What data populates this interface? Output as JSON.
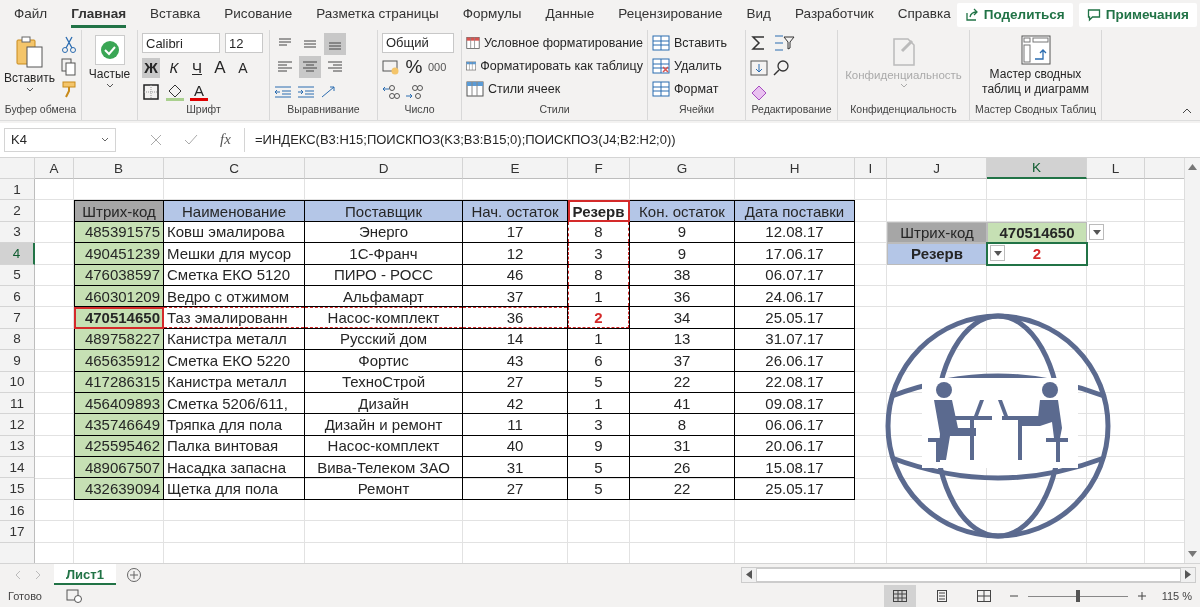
{
  "menu_tabs": [
    {
      "label": "Файл",
      "selected": false
    },
    {
      "label": "Главная",
      "selected": true
    },
    {
      "label": "Вставка",
      "selected": false
    },
    {
      "label": "Рисование",
      "selected": false
    },
    {
      "label": "Разметка страницы",
      "selected": false
    },
    {
      "label": "Формулы",
      "selected": false
    },
    {
      "label": "Данные",
      "selected": false
    },
    {
      "label": "Рецензирование",
      "selected": false
    },
    {
      "label": "Вид",
      "selected": false
    },
    {
      "label": "Разработчик",
      "selected": false
    },
    {
      "label": "Справка",
      "selected": false
    }
  ],
  "share_button": "Поделиться",
  "comments_button": "Примечания",
  "ribbon": {
    "clipboard": {
      "label": "Буфер обмена",
      "paste": "Вставить"
    },
    "quick": {
      "button": "Частые"
    },
    "font": {
      "label": "Шрифт",
      "font_name": "Calibri",
      "font_size": "12",
      "styles": [
        {
          "text": "Ж",
          "kind": "bold",
          "selected": true
        },
        {
          "text": "К",
          "kind": "italic",
          "selected": false
        },
        {
          "text": "Ч",
          "kind": "underline",
          "selected": false
        }
      ],
      "grow": "A",
      "shrink": "A",
      "color_letter": "A"
    },
    "alignment": {
      "label": "Выравнивание",
      "buttons": [
        {
          "kind": "top",
          "selected": false
        },
        {
          "kind": "middle",
          "selected": false
        },
        {
          "kind": "bottom",
          "selected": true
        },
        {
          "kind": "left",
          "selected": false
        },
        {
          "kind": "center",
          "selected": true
        },
        {
          "kind": "right",
          "selected": false
        }
      ]
    },
    "number": {
      "label": "Число",
      "format": "Общий",
      "percent": "%",
      "thousands": "000"
    },
    "styles": {
      "label": "Стили",
      "items": [
        "Условное форматирование",
        "Форматировать как таблицу",
        "Стили ячеек"
      ]
    },
    "cells": {
      "label": "Ячейки",
      "items": [
        "Вставить",
        "Удалить",
        "Формат"
      ]
    },
    "editing": {
      "label": "Редактирование"
    },
    "privacy": {
      "label": "Конфиденциальность",
      "button": "Конфиденциальность",
      "disabled": true
    },
    "pivot": {
      "label": "Мастер Сводных Таблиц",
      "button": "Мастер сводных таблиц и диаграмм"
    }
  },
  "name_box": "K4",
  "function_label": "fx",
  "formula": "=ИНДЕКС(B3:H15;ПОИСКПОЗ(K3;B3:B15;0);ПОИСКПОЗ(J4;B2:H2;0))",
  "columns": [
    {
      "letter": "A",
      "selected": false
    },
    {
      "letter": "B",
      "selected": false
    },
    {
      "letter": "C",
      "selected": false
    },
    {
      "letter": "D",
      "selected": false
    },
    {
      "letter": "E",
      "selected": false
    },
    {
      "letter": "F",
      "selected": false
    },
    {
      "letter": "G",
      "selected": false
    },
    {
      "letter": "H",
      "selected": false
    },
    {
      "letter": "I",
      "selected": false
    },
    {
      "letter": "J",
      "selected": false
    },
    {
      "letter": "K",
      "selected": true
    },
    {
      "letter": "L",
      "selected": false
    }
  ],
  "row_numbers": [
    {
      "number": "1",
      "selected": false
    },
    {
      "number": "2",
      "selected": false
    },
    {
      "number": "3",
      "selected": false
    },
    {
      "number": "4",
      "selected": true
    },
    {
      "number": "5",
      "selected": false
    },
    {
      "number": "6",
      "selected": false
    },
    {
      "number": "7",
      "selected": false
    },
    {
      "number": "8",
      "selected": false
    },
    {
      "number": "9",
      "selected": false
    },
    {
      "number": "10",
      "selected": false
    },
    {
      "number": "11",
      "selected": false
    },
    {
      "number": "12",
      "selected": false
    },
    {
      "number": "13",
      "selected": false
    },
    {
      "number": "14",
      "selected": false
    },
    {
      "number": "15",
      "selected": false
    },
    {
      "number": "16",
      "selected": false
    },
    {
      "number": "17",
      "selected": false
    }
  ],
  "table": {
    "header": [
      {
        "label": "Штрих-код",
        "color": "#a6a6a6",
        "highlighted": false
      },
      {
        "label": "Наименование",
        "color": "#b4c6e7",
        "highlighted": false
      },
      {
        "label": "Поставщик",
        "color": "#b4c6e7",
        "highlighted": false
      },
      {
        "label": "Нач. остаток",
        "color": "#b4c6e7",
        "highlighted": false
      },
      {
        "label": "Резерв",
        "color": "#ffffff",
        "highlighted": true
      },
      {
        "label": "Кон. остаток",
        "color": "#b4c6e7",
        "highlighted": false
      },
      {
        "label": "Дата поставки",
        "color": "#b4c6e7",
        "highlighted": false
      }
    ],
    "rows": [
      {
        "cells": [
          "485391575",
          "Ковш эмалирова",
          "Энерго",
          "17",
          "8",
          "9",
          "12.08.17"
        ],
        "highlighted": false
      },
      {
        "cells": [
          "490451239",
          "Мешки для мусор",
          "1С-Франч",
          "12",
          "3",
          "9",
          "17.06.17"
        ],
        "highlighted": false
      },
      {
        "cells": [
          "476038597",
          "Сметка ЕКО 5120",
          "ПИРО - РОСС",
          "46",
          "8",
          "38",
          "06.07.17"
        ],
        "highlighted": false
      },
      {
        "cells": [
          "460301209",
          "Ведро с отжимом",
          "Альфамарт",
          "37",
          "1",
          "36",
          "24.06.17"
        ],
        "highlighted": false
      },
      {
        "cells": [
          "470514650",
          "Таз эмалированн",
          "Насос-комплект",
          "36",
          "2",
          "34",
          "25.05.17"
        ],
        "highlighted": true
      },
      {
        "cells": [
          "489758227",
          "Канистра металл",
          "Русский дом",
          "14",
          "1",
          "13",
          "31.07.17"
        ],
        "highlighted": false
      },
      {
        "cells": [
          "465635912",
          "Сметка ЕКО 5220",
          "Фортис",
          "43",
          "6",
          "37",
          "26.06.17"
        ],
        "highlighted": false
      },
      {
        "cells": [
          "417286315",
          "Канистра металл",
          "ТехноСтрой",
          "27",
          "5",
          "22",
          "22.08.17"
        ],
        "highlighted": false
      },
      {
        "cells": [
          "456409893",
          "Сметка 5206/611,",
          "Дизайн",
          "42",
          "1",
          "41",
          "09.08.17"
        ],
        "highlighted": false
      },
      {
        "cells": [
          "435746649",
          "Тряпка для пола",
          "Дизайн и ремонт",
          "11",
          "3",
          "8",
          "06.06.17"
        ],
        "highlighted": false
      },
      {
        "cells": [
          "425595462",
          "Палка винтовая",
          "Насос-комплект",
          "40",
          "9",
          "31",
          "20.06.17"
        ],
        "highlighted": false
      },
      {
        "cells": [
          "489067507",
          "Насадка запасна",
          "Вива-Телеком ЗАО",
          "31",
          "5",
          "26",
          "15.08.17"
        ],
        "highlighted": false
      },
      {
        "cells": [
          "432639094",
          "Щетка для пола",
          "Ремонт",
          "27",
          "5",
          "22",
          "25.05.17"
        ],
        "highlighted": false
      }
    ]
  },
  "lookup": [
    {
      "label": "Штрих-код",
      "value": "470514650",
      "kind": "key",
      "selected": false
    },
    {
      "label": "Резерв",
      "value": "2",
      "kind": "result",
      "selected": true
    }
  ],
  "sheet_tabs": [
    {
      "label": "Лист1",
      "selected": true
    }
  ],
  "status": "Готово",
  "views": [
    {
      "kind": "normal",
      "selected": true
    },
    {
      "kind": "page-layout",
      "selected": false
    },
    {
      "kind": "page-break",
      "selected": false
    }
  ],
  "zoom": {
    "level": 0.5,
    "text": "115 %"
  }
}
